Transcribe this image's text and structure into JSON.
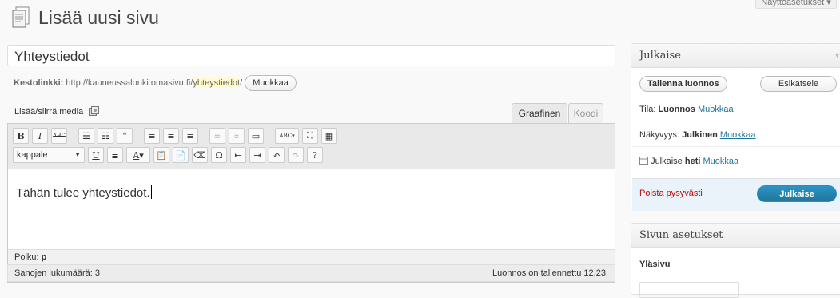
{
  "header": {
    "title": "Lisää uusi sivu",
    "screen_options": "Näyttöasetukset ▾"
  },
  "post": {
    "title": "Yhteystiedot",
    "permalink_label": "Kestolinkki:",
    "permalink_base": "http://kauneussalonki.omasivu.fi/",
    "permalink_slug": "yhteystiedot",
    "permalink_trail": "/",
    "edit_permalink": "Muokkaa"
  },
  "editor": {
    "media_label": "Lisää/siirrä media",
    "tabs": [
      "Graafinen",
      "Koodi"
    ],
    "format_select": "kappale",
    "content": "Tähän tulee yhteystiedot.",
    "path_label": "Polku:",
    "path_value": "p",
    "word_count": "Sanojen lukumäärä: 3",
    "draft_saved": "Luonnos on tallennettu 12.23."
  },
  "publish_box": {
    "title": "Julkaise",
    "save_draft": "Tallenna luonnos",
    "preview": "Esikatsele",
    "status_label": "Tila:",
    "status_value": "Luonnos",
    "visibility_label": "Näkyvyys:",
    "visibility_value": "Julkinen",
    "schedule_label": "Julkaise",
    "schedule_value": "heti",
    "edit": "Muokkaa",
    "delete": "Poista pysyvästi",
    "publish": "Julkaise"
  },
  "attributes_box": {
    "title": "Sivun asetukset",
    "parent_label": "Yläsivu"
  },
  "colors": {
    "link": "#21759b",
    "delete": "#bc0b0b",
    "publish_button": "#21759b"
  }
}
